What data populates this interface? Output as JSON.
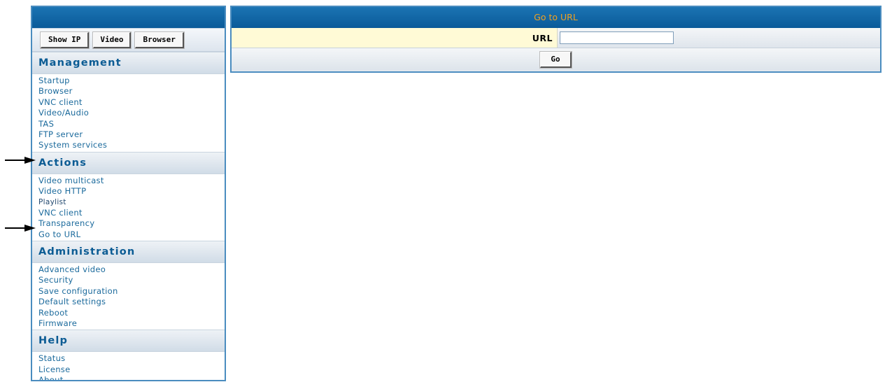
{
  "sidebar": {
    "buttons": [
      "Show IP",
      "Video",
      "Browser"
    ],
    "sections": [
      {
        "title": "Management",
        "items": [
          "Startup",
          "Browser",
          "VNC client",
          "Video/Audio",
          "TAS",
          "FTP server",
          "System services"
        ]
      },
      {
        "title": "Actions",
        "items": [
          "Video multicast",
          "Video HTTP",
          "Playlist",
          "VNC client",
          "Transparency",
          "Go to URL"
        ]
      },
      {
        "title": "Administration",
        "items": [
          "Advanced video",
          "Security",
          "Save configuration",
          "Default settings",
          "Reboot",
          "Firmware"
        ]
      },
      {
        "title": "Help",
        "items": [
          "Status",
          "License",
          "About"
        ]
      }
    ]
  },
  "panel": {
    "title": "Go to URL",
    "url_label": "URL",
    "url_value": "",
    "go_label": "Go"
  },
  "colors": {
    "header_blue": "#0f67a8",
    "title_orange": "#f0a020",
    "section_text": "#0c5c94",
    "link_text": "#1b6a9c",
    "label_highlight": "#fffad6"
  }
}
